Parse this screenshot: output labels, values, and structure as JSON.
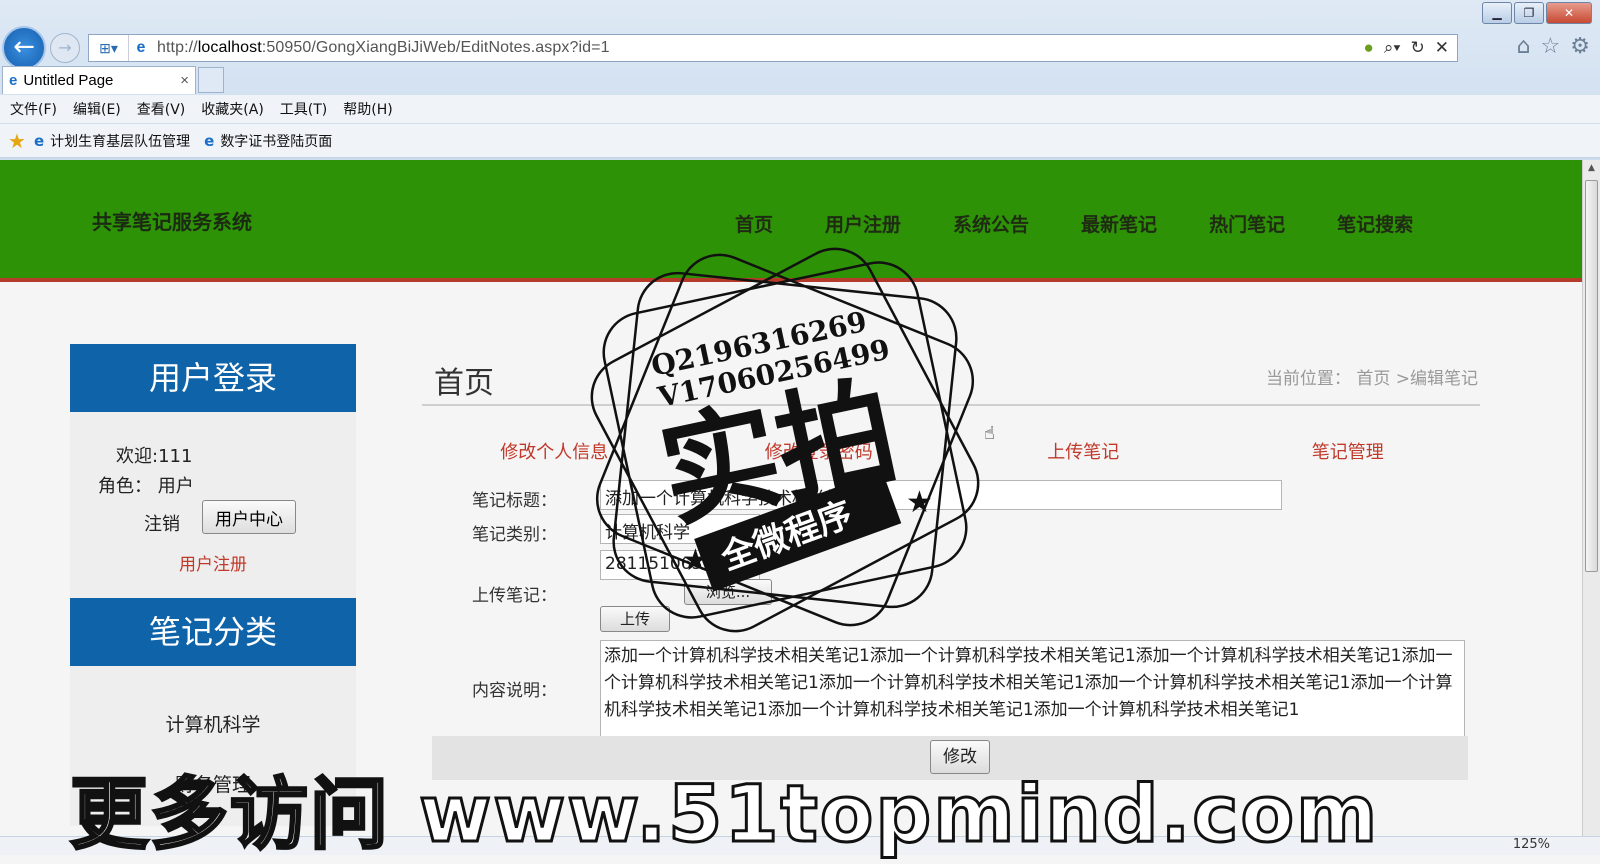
{
  "browser": {
    "url_prefix": "http://",
    "url_host": "localhost",
    "url_rest": ":50950/GongXiangBiJiWeb/EditNotes.aspx?id=1",
    "tab_title": "Untitled Page",
    "tab_close": "×",
    "menu": [
      "文件(F)",
      "编辑(E)",
      "查看(V)",
      "收藏夹(A)",
      "工具(T)",
      "帮助(H)"
    ],
    "favorites": [
      "计划生育基层队伍管理",
      "数字证书登陆页面"
    ],
    "zoom": "125%"
  },
  "site": {
    "title": "共享笔记服务系统",
    "nav": [
      "首页",
      "用户注册",
      "系统公告",
      "最新笔记",
      "热门笔记",
      "笔记搜索"
    ]
  },
  "login_panel": {
    "title": "用户登录",
    "welcome": "欢迎:111",
    "role": "角色： 用户",
    "logout": "注销",
    "user_center_button": "用户中心",
    "register_link": "用户注册"
  },
  "category_panel": {
    "title": "笔记分类",
    "items": [
      "计算机科学",
      "财务管理"
    ]
  },
  "content": {
    "title": "首页",
    "breadcrumb": "当前位置： 首页 >编辑笔记",
    "subnav": [
      "修改个人信息",
      "修改登录密码",
      "上传笔记",
      "笔记管理"
    ],
    "form": {
      "title_label": "笔记标题：",
      "title_value": "添加一个计算机科学技术相关笔记1",
      "category_label": "笔记类别：",
      "category_value": "计算机科学",
      "upload_label": "上传笔记：",
      "upload_value": "281151063",
      "browse_button": "浏览...",
      "upload_button": "上传",
      "desc_label": "内容说明：",
      "desc_value": "添加一个计算机科学技术相关笔记1添加一个计算机科学技术相关笔记1添加一个计算机科学技术相关笔记1添加一个计算机科学技术相关笔记1添加一个计算机科学技术相关笔记1添加一个计算机科学技术相关笔记1添加一个计算机科学技术相关笔记1添加一个计算机科学技术相关笔记1添加一个计算机科学技术相关笔记1",
      "submit_button": "修改"
    }
  },
  "watermark": {
    "stamp_line1": "Q2196316269",
    "stamp_line2": "V17060256499",
    "stamp_main": "实拍",
    "stamp_ribbon": "全微程序",
    "bottom_text": "更多访问 www.51topmind.com"
  }
}
